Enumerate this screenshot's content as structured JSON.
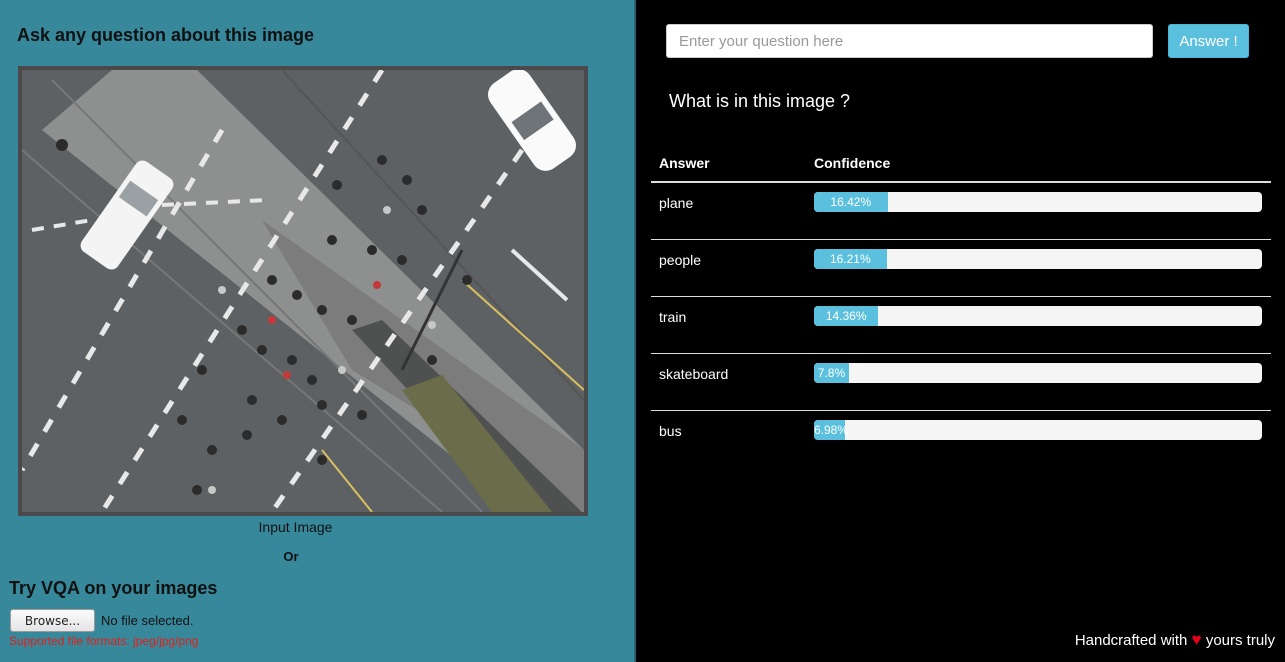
{
  "left": {
    "title": "Ask any question about this image",
    "image_caption": "Input Image",
    "or_label": "Or",
    "upload_title": "Try VQA on your images",
    "browse_label": "Browse...",
    "file_status": "No file selected.",
    "formats_note": "Supported file formats: jpeg/jpg/png"
  },
  "right": {
    "input_placeholder": "Enter your question here",
    "answer_button": "Answer !",
    "question": "What is in this image ?",
    "table_headers": {
      "answer": "Answer",
      "confidence": "Confidence"
    },
    "results": [
      {
        "answer": "plane",
        "confidence_label": "16.42%",
        "confidence": 16.42
      },
      {
        "answer": "people",
        "confidence_label": "16.21%",
        "confidence": 16.21
      },
      {
        "answer": "train",
        "confidence_label": "14.36%",
        "confidence": 14.36
      },
      {
        "answer": "skateboard",
        "confidence_label": "7.8%",
        "confidence": 7.8
      },
      {
        "answer": "bus",
        "confidence_label": "6.98%",
        "confidence": 6.98
      }
    ],
    "accent_color": "#5bc0de"
  },
  "footer": {
    "prefix": "Handcrafted with",
    "suffix": "yours truly",
    "icon": "heart-icon"
  }
}
